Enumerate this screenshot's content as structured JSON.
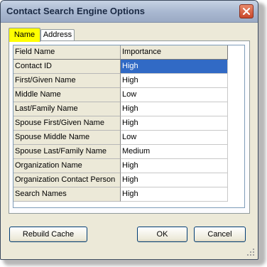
{
  "window": {
    "title": "Contact Search Engine Options"
  },
  "tabs": [
    {
      "label": "Name",
      "active": true
    },
    {
      "label": "Address",
      "active": false
    }
  ],
  "grid": {
    "headers": [
      "Field Name",
      "Importance"
    ],
    "rows": [
      {
        "field": "Contact ID",
        "importance": "High",
        "selected": true
      },
      {
        "field": "First/Given Name",
        "importance": "High"
      },
      {
        "field": "Middle Name",
        "importance": "Low"
      },
      {
        "field": "Last/Family Name",
        "importance": "High"
      },
      {
        "field": "Spouse First/Given Name",
        "importance": "High"
      },
      {
        "field": "Spouse Middle Name",
        "importance": "Low"
      },
      {
        "field": "Spouse Last/Family Name",
        "importance": "Medium"
      },
      {
        "field": "Organization Name",
        "importance": "High"
      },
      {
        "field": "Organization Contact Person",
        "importance": "High"
      },
      {
        "field": "Search Names",
        "importance": "High"
      }
    ]
  },
  "buttons": {
    "rebuild_cache": "Rebuild Cache",
    "ok": "OK",
    "cancel": "Cancel"
  },
  "colors": {
    "active_tab": "#ffff00",
    "selection": "#316ac5",
    "window_face": "#ece9d8"
  }
}
